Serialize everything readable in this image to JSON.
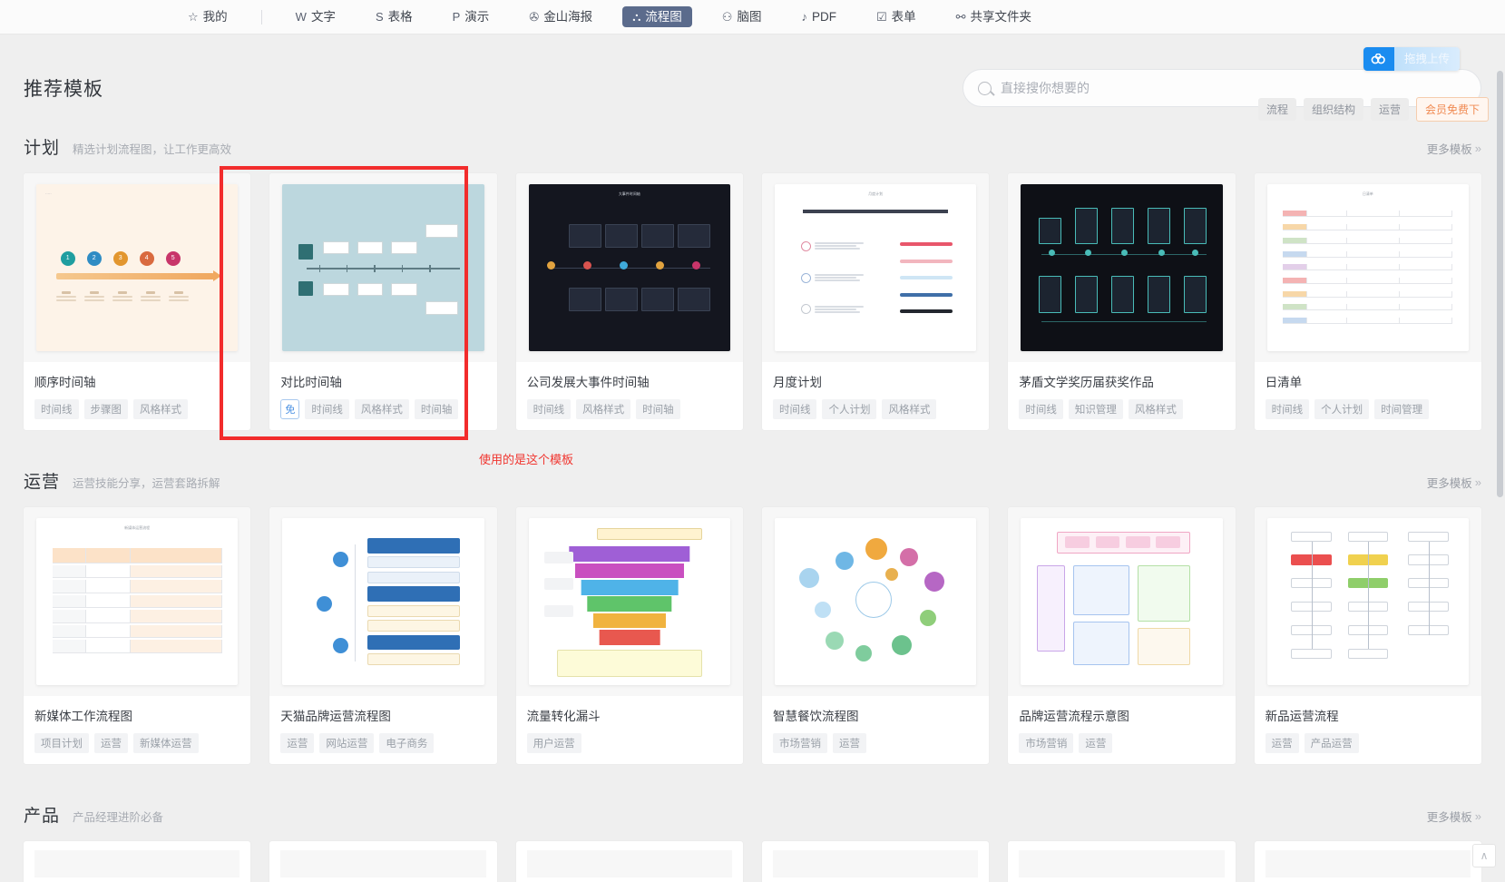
{
  "topnav": {
    "items": [
      {
        "label": "我的",
        "icon": "star-icon",
        "glyph": "☆",
        "active": false
      },
      {
        "label": "文字",
        "icon": "writer-w-icon",
        "glyph": "W",
        "active": false
      },
      {
        "label": "表格",
        "icon": "spreadsheet-s-icon",
        "glyph": "S",
        "active": false
      },
      {
        "label": "演示",
        "icon": "presentation-p-icon",
        "glyph": "P",
        "active": false
      },
      {
        "label": "金山海报",
        "icon": "poster-icon",
        "glyph": "✇",
        "active": false
      },
      {
        "label": "流程图",
        "icon": "flowchart-icon",
        "glyph": "⛬",
        "active": true
      },
      {
        "label": "脑图",
        "icon": "mindmap-icon",
        "glyph": "⚇",
        "active": false
      },
      {
        "label": "PDF",
        "icon": "pdf-icon",
        "glyph": "♪",
        "active": false
      },
      {
        "label": "表单",
        "icon": "form-icon",
        "glyph": "☑",
        "active": false
      },
      {
        "label": "共享文件夹",
        "icon": "shared-folder-icon",
        "glyph": "⚯",
        "active": false
      }
    ]
  },
  "header": {
    "title": "推荐模板",
    "search": {
      "placeholder": "直接搜你想要的",
      "value": "",
      "icon": "search-icon"
    },
    "upload_badge": {
      "label": "拖拽上传",
      "icon": "cloud-upload-icon",
      "color": "#1a8cf0"
    },
    "quick_tags": [
      {
        "label": "流程",
        "vip": false
      },
      {
        "label": "组织结构",
        "vip": false
      },
      {
        "label": "运营",
        "vip": false
      },
      {
        "label": "会员免费下",
        "vip": true
      }
    ]
  },
  "annotation": {
    "text": "使用的是这个模板",
    "color": "#f0352f",
    "selected_card_index": 1
  },
  "sections": [
    {
      "title": "计划",
      "subtitle": "精选计划流程图，让工作更高效",
      "more_label": "更多模板",
      "more_icon": "chevron-double-right-icon",
      "cards": [
        {
          "title": "顺序时间轴",
          "tags": [
            "时间线",
            "步骤图",
            "风格样式"
          ],
          "free": false,
          "art": "beige-timeline"
        },
        {
          "title": "对比时间轴",
          "tags": [
            "时间线",
            "风格样式",
            "时间轴"
          ],
          "free": true,
          "free_label": "免",
          "art": "blue-timeline"
        },
        {
          "title": "公司发展大事件时间轴",
          "tags": [
            "时间线",
            "风格样式",
            "时间轴"
          ],
          "free": false,
          "art": "dark-timeline"
        },
        {
          "title": "月度计划",
          "tags": [
            "时间线",
            "个人计划",
            "风格样式"
          ],
          "free": false,
          "art": "white-plan"
        },
        {
          "title": "茅盾文学奖历届获奖作品",
          "tags": [
            "时间线",
            "知识管理",
            "风格样式"
          ],
          "free": false,
          "art": "dark-fan"
        },
        {
          "title": "日清单",
          "tags": [
            "时间线",
            "个人计划",
            "时间管理"
          ],
          "free": false,
          "art": "white-sheet"
        }
      ]
    },
    {
      "title": "运营",
      "subtitle": "运营技能分享，运营套路拆解",
      "more_label": "更多模板",
      "more_icon": "chevron-double-right-icon",
      "cards": [
        {
          "title": "新媒体工作流程图",
          "tags": [
            "项目计划",
            "运营",
            "新媒体运营"
          ],
          "free": false,
          "art": "orange-table"
        },
        {
          "title": "天猫品牌运营流程图",
          "tags": [
            "运营",
            "网站运营",
            "电子商务"
          ],
          "free": false,
          "art": "blue-tree"
        },
        {
          "title": "流量转化漏斗",
          "tags": [
            "用户运营"
          ],
          "free": false,
          "art": "funnel"
        },
        {
          "title": "智慧餐饮流程图",
          "tags": [
            "市场营销",
            "运营"
          ],
          "free": false,
          "art": "bubbles"
        },
        {
          "title": "品牌运营流程示意图",
          "tags": [
            "市场营销",
            "运营"
          ],
          "free": false,
          "art": "pink-flow"
        },
        {
          "title": "新品运营流程",
          "tags": [
            "运营",
            "产品运营"
          ],
          "free": false,
          "art": "green-flow"
        }
      ]
    },
    {
      "title": "产品",
      "subtitle": "产品经理进阶必备",
      "more_label": "更多模板",
      "more_icon": "chevron-double-right-icon",
      "cards": []
    }
  ],
  "to_top": {
    "label": "∧",
    "icon": "chevron-up-icon"
  }
}
